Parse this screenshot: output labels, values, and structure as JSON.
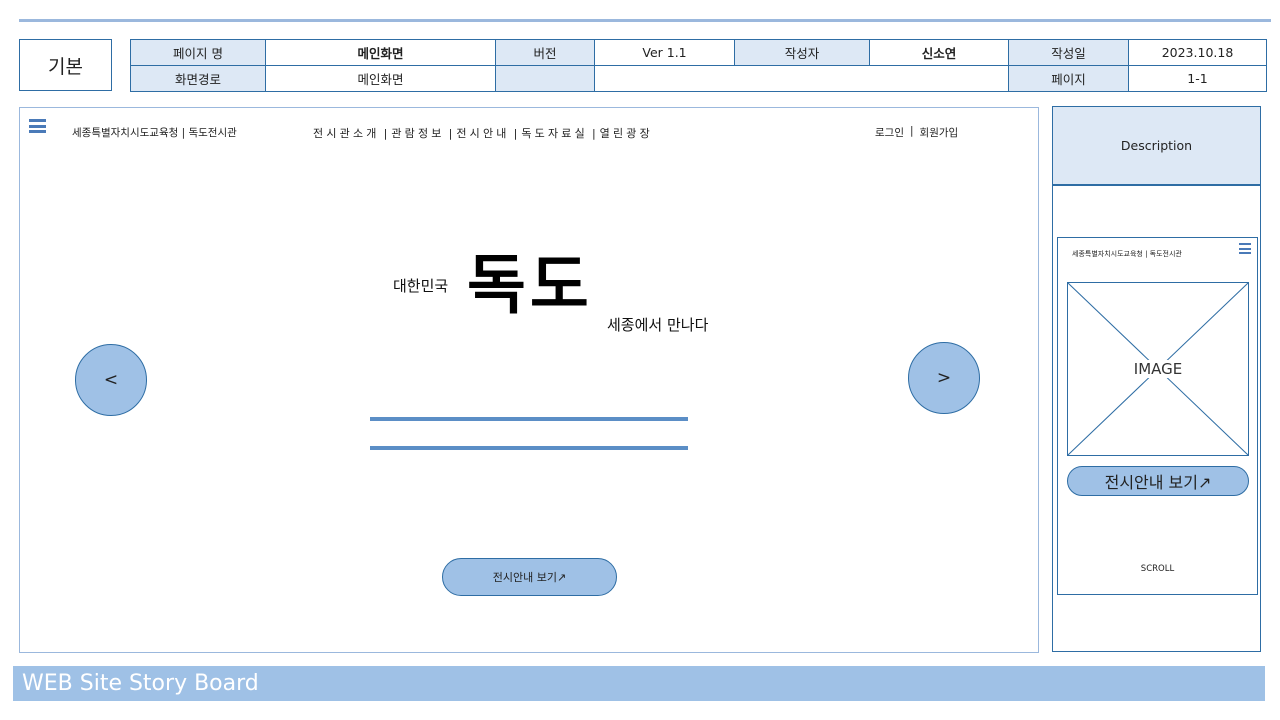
{
  "header": {
    "category": "기본",
    "meta": {
      "page_name_label": "페이지 명",
      "page_name_value": "메인화면",
      "version_label": "버전",
      "version_value": "Ver 1.1",
      "author_label": "작성자",
      "author_value": "신소연",
      "date_label": "작성일",
      "date_value": "2023.10.18",
      "path_label": "화면경로",
      "path_value": "메인화면",
      "page_label": "페이지",
      "page_value": "1-1"
    }
  },
  "site": {
    "brand": "세종특별자치시도교육청 | 독도전시관",
    "nav": [
      "전시관소개",
      "관람정보",
      "전시안내",
      "독도자료실",
      "열린광장"
    ],
    "nav_separator": "|",
    "account": {
      "login": "로그인",
      "signup": "회원가입",
      "separator": "|"
    },
    "hero": {
      "prefix": "대한민국",
      "title": "독도",
      "suffix": "세종에서 만나다"
    },
    "prev_label": "<",
    "next_label": ">",
    "cta_label": "전시안내 보기↗"
  },
  "description": {
    "title": "Description",
    "mobile": {
      "brand": "세종특별자치시도교육청 | 독도전시관",
      "image_label": "IMAGE",
      "cta_label": "전시안내 보기↗",
      "scroll_label": "SCROLL"
    }
  },
  "footer": {
    "title": "WEB Site Story Board"
  },
  "colors": {
    "accent": "#2e6da4",
    "header_fill": "#dde8f5",
    "button_fill": "#9fc1e6",
    "footer_fill": "#9fc1e6"
  }
}
